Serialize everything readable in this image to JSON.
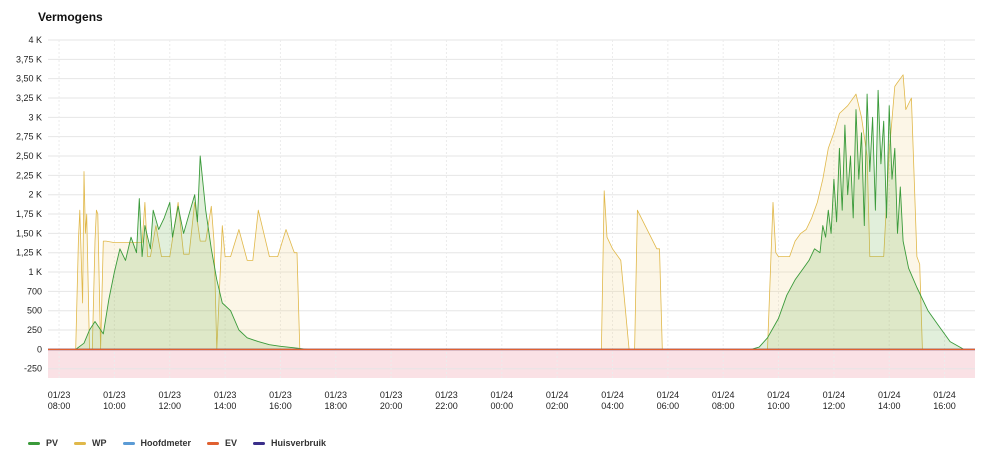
{
  "chart_data": {
    "type": "area",
    "title": "Vermogens",
    "y_ticks": [
      "4 K",
      "3,75 K",
      "3,50 K",
      "3,25 K",
      "3 K",
      "2,75 K",
      "2,50 K",
      "2,25 K",
      "2 K",
      "1,75 K",
      "1,50 K",
      "1,25 K",
      "1 K",
      "700",
      "500",
      "250",
      "0",
      "-250"
    ],
    "y_tick_values": [
      4000,
      3750,
      3500,
      3250,
      3000,
      2750,
      2500,
      2250,
      2000,
      1750,
      1500,
      1250,
      1000,
      750,
      500,
      250,
      0,
      -250
    ],
    "ylim": [
      -370,
      4000
    ],
    "x_range_hours": [
      7.6,
      41.1
    ],
    "x_ticks": [
      {
        "date": "01/23",
        "time": "08:00",
        "h": 8
      },
      {
        "date": "01/23",
        "time": "10:00",
        "h": 10
      },
      {
        "date": "01/23",
        "time": "12:00",
        "h": 12
      },
      {
        "date": "01/23",
        "time": "14:00",
        "h": 14
      },
      {
        "date": "01/23",
        "time": "16:00",
        "h": 16
      },
      {
        "date": "01/23",
        "time": "18:00",
        "h": 18
      },
      {
        "date": "01/23",
        "time": "20:00",
        "h": 20
      },
      {
        "date": "01/23",
        "time": "22:00",
        "h": 22
      },
      {
        "date": "01/24",
        "time": "00:00",
        "h": 24
      },
      {
        "date": "01/24",
        "time": "02:00",
        "h": 26
      },
      {
        "date": "01/24",
        "time": "04:00",
        "h": 28
      },
      {
        "date": "01/24",
        "time": "06:00",
        "h": 30
      },
      {
        "date": "01/24",
        "time": "08:00",
        "h": 32
      },
      {
        "date": "01/24",
        "time": "10:00",
        "h": 34
      },
      {
        "date": "01/24",
        "time": "12:00",
        "h": 36
      },
      {
        "date": "01/24",
        "time": "14:00",
        "h": 38
      },
      {
        "date": "01/24",
        "time": "16:00",
        "h": 40
      }
    ],
    "grid": true,
    "legend_position": "bottom-left",
    "series": [
      {
        "name": "PV",
        "color": "#3a9a3a",
        "fill": "rgba(120,180,90,0.22)",
        "x": [
          7.6,
          8.6,
          8.9,
          9.1,
          9.3,
          9.6,
          9.8,
          10.0,
          10.2,
          10.4,
          10.6,
          10.8,
          10.9,
          11.0,
          11.1,
          11.3,
          11.4,
          11.6,
          11.8,
          12.0,
          12.1,
          12.3,
          12.5,
          12.7,
          12.9,
          13.0,
          13.1,
          13.3,
          13.5,
          13.7,
          13.9,
          14.2,
          14.5,
          14.8,
          15.2,
          15.6,
          16.0,
          16.5,
          17.0,
          33.0,
          33.3,
          33.6,
          34.0,
          34.3,
          34.6,
          34.9,
          35.1,
          35.3,
          35.5,
          35.6,
          35.7,
          35.8,
          35.9,
          36.0,
          36.1,
          36.2,
          36.3,
          36.4,
          36.5,
          36.6,
          36.7,
          36.8,
          36.9,
          37.0,
          37.1,
          37.2,
          37.3,
          37.4,
          37.5,
          37.6,
          37.7,
          37.8,
          37.9,
          38.0,
          38.1,
          38.2,
          38.3,
          38.4,
          38.5,
          38.7,
          39.0,
          39.4,
          39.8,
          40.2,
          40.7
        ],
        "values": [
          0,
          0,
          80,
          250,
          360,
          200,
          650,
          1000,
          1300,
          1150,
          1450,
          1250,
          1950,
          1200,
          1600,
          1300,
          1800,
          1550,
          1700,
          1900,
          1450,
          1850,
          1500,
          1750,
          2000,
          1650,
          2500,
          1800,
          1300,
          900,
          600,
          500,
          250,
          150,
          100,
          60,
          40,
          20,
          0,
          0,
          30,
          150,
          400,
          700,
          900,
          1050,
          1150,
          1300,
          1250,
          1600,
          1450,
          1800,
          1500,
          2200,
          1650,
          2600,
          1800,
          2900,
          2000,
          2500,
          1700,
          3100,
          2200,
          2800,
          1600,
          3300,
          2300,
          3000,
          1800,
          3350,
          2400,
          2950,
          1700,
          3150,
          2200,
          2600,
          1500,
          2100,
          1400,
          1050,
          800,
          500,
          300,
          100,
          0
        ]
      },
      {
        "name": "WP",
        "color": "#e0b84a",
        "fill": "rgba(240,205,120,0.18)",
        "x": [
          7.6,
          8.6,
          8.7,
          8.75,
          8.85,
          8.9,
          8.95,
          9.0,
          9.1,
          9.2,
          9.3,
          9.35,
          9.4,
          9.5,
          9.6,
          9.7,
          10.0,
          10.5,
          11.0,
          11.1,
          11.2,
          11.3,
          11.5,
          11.7,
          12.0,
          12.3,
          12.5,
          12.7,
          12.9,
          13.1,
          13.3,
          13.5,
          13.6,
          13.7,
          13.9,
          14.0,
          14.2,
          14.5,
          14.8,
          15.0,
          15.2,
          15.6,
          15.9,
          16.2,
          16.5,
          16.6,
          16.7,
          17.0,
          27.6,
          27.7,
          27.8,
          28.0,
          28.3,
          28.6,
          28.8,
          28.9,
          29.6,
          29.7,
          29.8,
          30.0,
          30.1,
          30.2,
          33.6,
          33.8,
          33.9,
          34.0,
          34.2,
          34.4,
          34.6,
          34.8,
          35.0,
          35.2,
          35.4,
          35.6,
          35.8,
          36.0,
          36.2,
          36.5,
          36.8,
          37.0,
          37.2,
          37.3,
          37.5,
          37.8,
          38.0,
          38.2,
          38.3,
          38.5,
          38.6,
          38.8,
          39.0,
          39.1,
          39.2,
          39.3,
          39.5,
          39.8,
          40.0
        ],
        "values": [
          0,
          0,
          1400,
          1800,
          600,
          2300,
          1500,
          1750,
          0,
          0,
          1400,
          1800,
          1750,
          0,
          1400,
          1400,
          1380,
          1380,
          1380,
          1900,
          1200,
          1200,
          1600,
          1200,
          1200,
          1900,
          1230,
          1230,
          1900,
          1400,
          1400,
          1850,
          1400,
          0,
          1600,
          1200,
          1200,
          1550,
          1150,
          1150,
          1800,
          1200,
          1200,
          1550,
          1250,
          1250,
          0,
          0,
          0,
          2050,
          1450,
          1300,
          1150,
          0,
          0,
          1800,
          1300,
          1300,
          0,
          0,
          0,
          0,
          0,
          1900,
          1250,
          1200,
          1200,
          1200,
          1400,
          1500,
          1550,
          1700,
          1900,
          2200,
          2600,
          2800,
          3050,
          3150,
          3300,
          3000,
          2500,
          1200,
          1200,
          1200,
          2550,
          3400,
          3450,
          3550,
          3100,
          3250,
          1200,
          1100,
          0,
          0,
          0,
          0,
          0
        ]
      },
      {
        "name": "Hoofdmeter",
        "color": "#5b9bd5",
        "x": [
          7.6,
          41.1
        ],
        "values": [
          0,
          0
        ]
      },
      {
        "name": "EV",
        "color": "#e06030",
        "x": [
          7.6,
          41.1
        ],
        "values": [
          0,
          0
        ]
      },
      {
        "name": "Huisverbruik",
        "color": "#3a2e8a",
        "x": [
          7.6,
          41.1
        ],
        "values": [
          0,
          0
        ]
      }
    ],
    "negative_band": {
      "color": "rgba(240,170,180,0.35)"
    }
  }
}
